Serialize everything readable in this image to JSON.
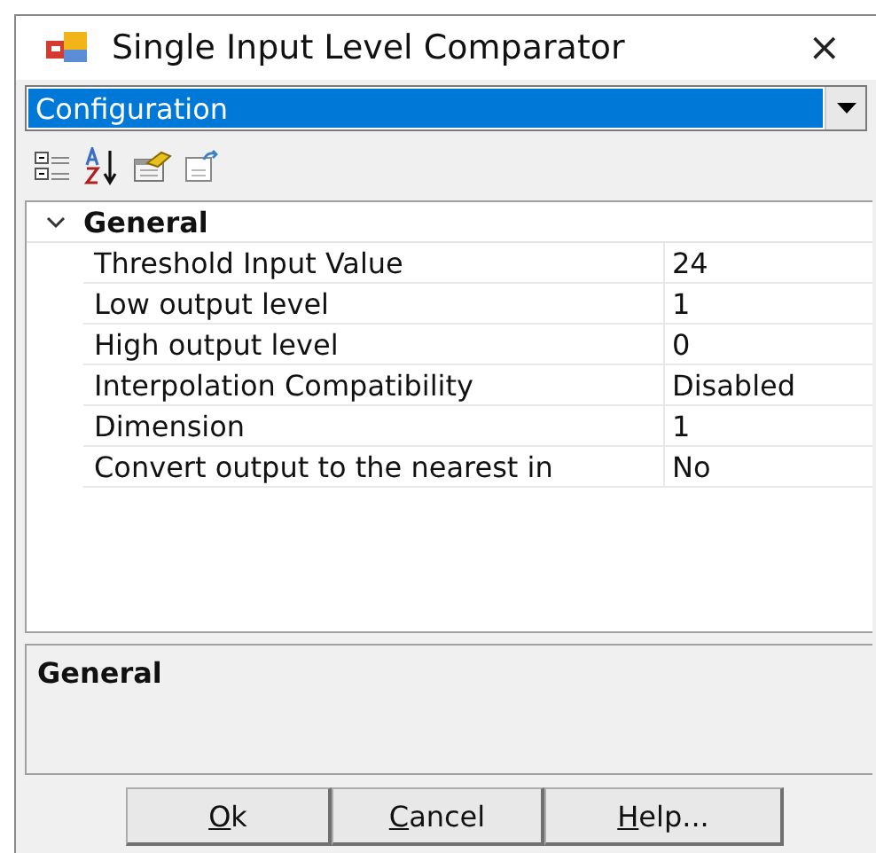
{
  "window": {
    "title": "Single Input Level Comparator",
    "close": "×"
  },
  "object_selector": {
    "value": "Configuration",
    "selected": true
  },
  "toolbar": {
    "buttons": [
      {
        "kind": "categorized"
      },
      {
        "kind": "alphabetical"
      },
      {
        "kind": "properties"
      },
      {
        "kind": "pages"
      }
    ]
  },
  "property_grid": {
    "categories": [
      {
        "name": "General",
        "expanded": true,
        "properties": [
          {
            "name": "Threshold Input Value",
            "value": "24"
          },
          {
            "name": "Low output level",
            "value": "1"
          },
          {
            "name": "High output level",
            "value": "0"
          },
          {
            "name": "Interpolation Compatibility",
            "value": "Disabled"
          },
          {
            "name": "Dimension",
            "value": "1"
          },
          {
            "name": "Convert output to the nearest in",
            "value": "No"
          }
        ]
      }
    ]
  },
  "description": {
    "title": "General"
  },
  "buttons": [
    {
      "label": "Ok",
      "mnemonic_underlined": true
    },
    {
      "label": "Cancel",
      "mnemonic_underlined": true
    },
    {
      "label": "Help...",
      "mnemonic_underlined": true
    }
  ]
}
